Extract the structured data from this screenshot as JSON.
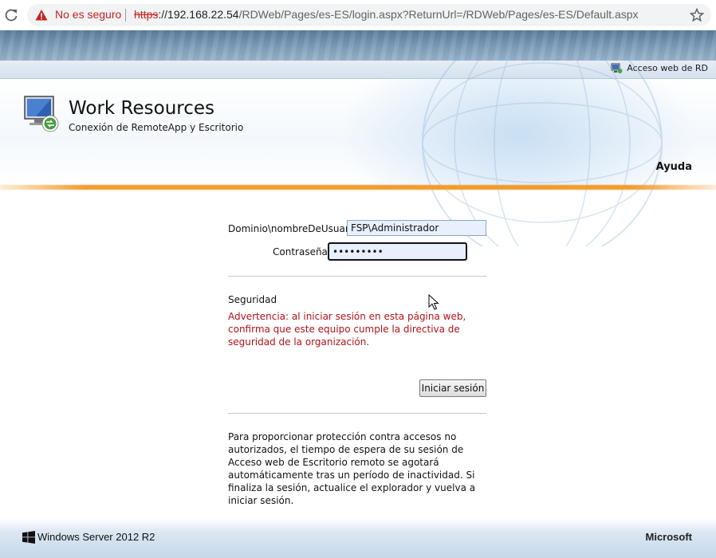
{
  "browser": {
    "security_label": "No es seguro",
    "url_scheme": "https",
    "url_sep": "://",
    "url_host": "192.168.22.54",
    "url_path": "/RDWeb/Pages/es-ES/login.aspx?ReturnUrl=/RDWeb/Pages/es-ES/Default.aspx"
  },
  "header": {
    "rd_link": "Acceso web de RD",
    "title": "Work Resources",
    "subtitle": "Conexión de RemoteApp y Escritorio",
    "help": "Ayuda"
  },
  "form": {
    "username_label": "Dominio\\nombreDeUsuario:",
    "username_value": "FSP\\Administrador",
    "password_label": "Contraseña:",
    "password_value": "•••••••••",
    "security_title": "Seguridad",
    "security_warning": "Advertencia: al iniciar sesión en esta página web, confirma que este equipo cumple la directiva de seguridad de la organización.",
    "signin_button": "Iniciar sesión",
    "info": "Para proporcionar protección contra accesos no autorizados, el tiempo de espera de su sesión de Acceso web de Escritorio remoto se agotará automáticamente tras un período de inactividad. Si finaliza la sesión, actualice el explorador y vuelva a iniciar sesión."
  },
  "footer": {
    "product": "Windows Server 2012 R2",
    "vendor": "Microsoft"
  },
  "colors": {
    "warning": "#b0121a",
    "accent_orange": "#f39b2c",
    "insecure": "#c5221f"
  }
}
